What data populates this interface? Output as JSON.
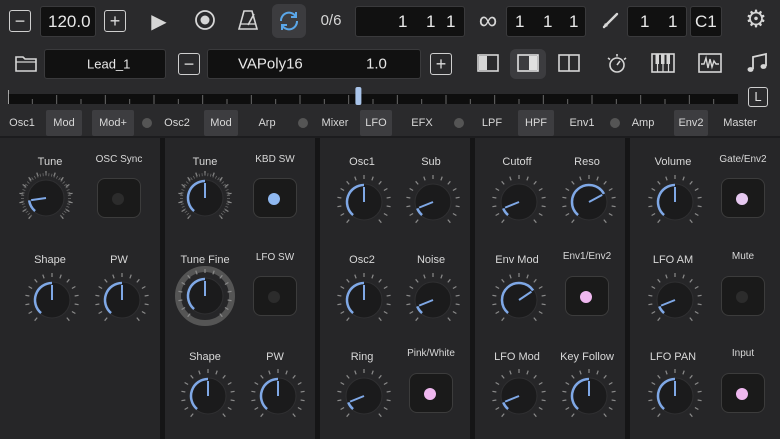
{
  "transport": {
    "tempo": "120.0",
    "step_counter": "0/6",
    "position": [
      "1",
      "1",
      "1"
    ],
    "loop_length": [
      "1",
      "1",
      "1"
    ],
    "edit_position": [
      "1",
      "1"
    ],
    "key": "C1"
  },
  "preset": {
    "track_name": "Lead_1",
    "patch_name": "VAPoly16",
    "patch_version": "1.0"
  },
  "ruler": {
    "button_label": "L",
    "thumb_fraction": 0.48
  },
  "tabs": [
    {
      "label": "Osc1",
      "active": false
    },
    {
      "label": "Mod",
      "active": true
    },
    {
      "label": "Mod+",
      "active": true
    },
    {
      "label": "Osc2",
      "active": false
    },
    {
      "label": "Mod",
      "active": true
    },
    {
      "label": "Arp",
      "active": false
    },
    {
      "label": "Mixer",
      "active": false
    },
    {
      "label": "LFO",
      "active": true
    },
    {
      "label": "EFX",
      "active": false
    },
    {
      "label": "LPF",
      "active": false
    },
    {
      "label": "HPF",
      "active": true
    },
    {
      "label": "Env1",
      "active": false
    },
    {
      "label": "Amp",
      "active": false
    },
    {
      "label": "Env2",
      "active": true
    },
    {
      "label": "Master",
      "active": false
    }
  ],
  "controls": {
    "osc1": {
      "tune": {
        "label": "Tune",
        "value": 0.15,
        "style": "fine"
      },
      "osc_sync": {
        "label": "OSC Sync",
        "on": false
      },
      "shape": {
        "label": "Shape",
        "value": 0.5
      },
      "pw": {
        "label": "PW",
        "value": 0.5
      }
    },
    "osc2": {
      "tune": {
        "label": "Tune",
        "value": 0.5,
        "style": "fine"
      },
      "kbd_sw": {
        "label": "KBD SW",
        "on": true,
        "color": "#8fb8f0"
      },
      "tune_fine": {
        "label": "Tune Fine",
        "value": 0.5,
        "style": "ring"
      },
      "lfo_sw": {
        "label": "LFO SW",
        "on": false
      },
      "shape": {
        "label": "Shape",
        "value": 0.5
      },
      "pw": {
        "label": "PW",
        "value": 0.5
      }
    },
    "mixer": {
      "osc1": {
        "label": "Osc1",
        "value": 0.5
      },
      "sub": {
        "label": "Sub",
        "value": 0.1
      },
      "osc2": {
        "label": "Osc2",
        "value": 0.5
      },
      "noise": {
        "label": "Noise",
        "value": 0.1
      },
      "ring": {
        "label": "Ring",
        "value": 0.1
      },
      "pink_white": {
        "label": "Pink/White",
        "on": true,
        "color": "#f0b8f0"
      }
    },
    "filter": {
      "cutoff": {
        "label": "Cutoff",
        "value": 0.1
      },
      "reso": {
        "label": "Reso",
        "value": 0.72
      },
      "env_mod": {
        "label": "Env Mod",
        "value": 0.7
      },
      "env1_env2": {
        "label": "Env1/Env2",
        "on": true,
        "color": "#f0b8f0"
      },
      "lfo_mod": {
        "label": "LFO Mod",
        "value": 0.1
      },
      "key_follow": {
        "label": "Key Follow",
        "value": 0.5
      }
    },
    "amp": {
      "volume": {
        "label": "Volume",
        "value": 0.5
      },
      "gate_env2": {
        "label": "Gate/Env2",
        "on": true,
        "color": "#e6c8f0"
      },
      "lfo_am": {
        "label": "LFO AM",
        "value": 0.1
      },
      "mute": {
        "label": "Mute",
        "on": false
      },
      "lfo_pan": {
        "label": "LFO PAN",
        "value": 0.5
      },
      "input": {
        "label": "Input",
        "on": true,
        "color": "#f0b8f0"
      }
    }
  },
  "colors": {
    "accent": "#7fa8e6",
    "switch_on_pink": "#f0b8f0",
    "switch_on_blue": "#8fb8f0"
  }
}
